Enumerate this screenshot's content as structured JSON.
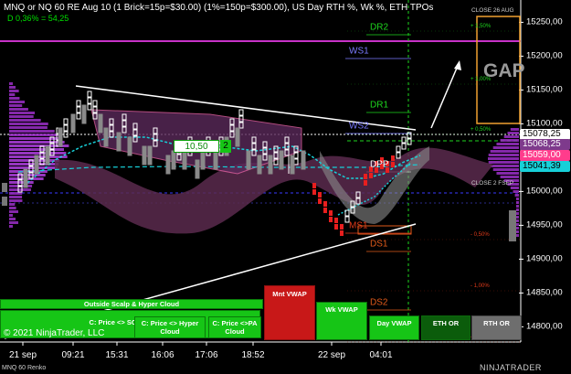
{
  "header": {
    "title": "MNQ or NQ 60 RE Aug 10 (1 Brick=15p=$30.00) (1%=150p=$300.00), US Day RTH %, Wk %, ETH TPOs",
    "subtitle": "D 0,36% = 54,25"
  },
  "footer": {
    "copyright": "© 2021 NinjaTrader, LLC",
    "series_label": "MNQ 60 Renko",
    "brand": "NINJATRADER"
  },
  "annotations": {
    "gap": "GAP",
    "close_aug": "CLOSE 26 AUG",
    "close_sep": "CLOSE 2 FSEP",
    "tracker_price": "10,50",
    "tracker_count": "2"
  },
  "chart_data": {
    "type": "candlestick",
    "x_tick_labels": [
      "21 sep",
      "09:21",
      "15:31",
      "16:06",
      "17:06",
      "18:52",
      "22 sep",
      "04:01"
    ],
    "y_tick_labels": [
      "15250,00",
      "15200,00",
      "15150,00",
      "15100,00",
      "15000,00",
      "14950,00",
      "14900,00",
      "14850,00",
      "14800,00"
    ],
    "ylim": [
      14780,
      15270
    ],
    "price_badges": [
      {
        "label": "15078,25",
        "bg": "#ffffff",
        "fg": "#000000"
      },
      {
        "label": "15068,25",
        "bg": "#7e3a8c",
        "fg": "#ffffff"
      },
      {
        "label": "15059,00",
        "bg": "#ff3c8c",
        "fg": "#ffffff"
      },
      {
        "label": "15041,39",
        "bg": "#17d0d8",
        "fg": "#000000"
      }
    ],
    "percent_levels": [
      {
        "label": "+ 1,50%",
        "color": "#1ed61e"
      },
      {
        "label": "+ 1,00%",
        "color": "#1ed61e"
      },
      {
        "label": "+ 0,50%",
        "color": "#1ed61e"
      },
      {
        "label": "- 0,50%",
        "color": "#e03a1a"
      },
      {
        "label": "- 1,00%",
        "color": "#e03a1a"
      },
      {
        "label": "- 1,50%",
        "color": "#e03a1a"
      }
    ],
    "levels": [
      {
        "label": "DR2",
        "color": "#1ed61e"
      },
      {
        "label": "WS1",
        "color": "#7a7aff"
      },
      {
        "label": "DR1",
        "color": "#1ed61e"
      },
      {
        "label": "WS2",
        "color": "#7a7aff"
      },
      {
        "label": "DPP",
        "color": "#ffffff"
      },
      {
        "label": "MS1",
        "color": "#e03a1a"
      },
      {
        "label": "DS1",
        "color": "#e05a1a"
      },
      {
        "label": "DS2",
        "color": "#e05a1a"
      }
    ],
    "colors": {
      "up_bar": "#ffffff",
      "down_bar": "#8a8a8a",
      "down_bar_recent": "#e81e1e",
      "cloud_outer": "#5a2a4e",
      "cloud_inner": "#7a3a6e",
      "volume_profile": "#9b2fc8",
      "vwap_line": "#17d0d8",
      "week_high_line": "#c832c8"
    }
  },
  "buttons": [
    {
      "id": "outside-scalp-hyper",
      "label": "Outside Scalp & Hyper Cloud"
    },
    {
      "id": "scalp-cloud",
      "label": "C: Price <> SCALP Cloud"
    },
    {
      "id": "hyper-cloud",
      "label": "C: Price <> Hyper Cloud"
    },
    {
      "id": "pa-cloud",
      "label": "C: Price <>PA Cloud"
    },
    {
      "id": "mnt-vwap",
      "label": "Mnt VWAP"
    },
    {
      "id": "wk-vwap",
      "label": "Wk VWAP"
    },
    {
      "id": "day-vwap",
      "label": "Day VWAP"
    },
    {
      "id": "eth-or",
      "label": "ETH OR"
    },
    {
      "id": "rth-or",
      "label": "RTH OR"
    }
  ]
}
